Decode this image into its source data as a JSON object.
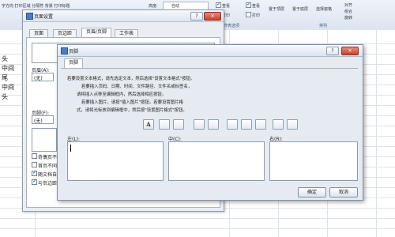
{
  "ribbon": {
    "items_left": "字方向 打印区域 分隔符 背景 打印标题",
    "height_label": "高度:",
    "height_value": "自动",
    "view_label": "查看",
    "view_label2": "查看",
    "print_label": "打印",
    "print_label2": "打印",
    "bring_forward": "置于顶层",
    "send_back": "置于底层",
    "selection_pane": "选择窗格",
    "align": "对齐",
    "group": "组合",
    "rotate": "旋转",
    "sheet_options": "作表选项",
    "arrange": "排列"
  },
  "sheet": {
    "cells": [
      "头",
      "中间",
      "尾",
      "中间",
      "头"
    ]
  },
  "page_setup": {
    "title": "页面设置",
    "help_icon": "?",
    "close_icon": "✕",
    "tabs": [
      "页面",
      "页边距",
      "页眉/页脚",
      "工作表"
    ],
    "header_label": "页眉(A):",
    "header_value": "(无)",
    "footer_label": "页脚(F):",
    "footer_value": "(无)",
    "checkboxes": [
      {
        "label": "奇偶页不同",
        "checked": false
      },
      {
        "label": "首页不同",
        "checked": false
      },
      {
        "label": "随文档自动缩放",
        "checked": true
      },
      {
        "label": "与页边距对齐",
        "checked": true
      }
    ]
  },
  "footer_dialog": {
    "title": "页脚",
    "help_icon": "?",
    "close_icon": "✕",
    "tab": "页脚",
    "instructions": [
      "若要设置文本格式，请先选定文本，然后选择\"设置文本格式\"按钮。",
      "若要插入页码、日期、时间、文件路径、文件名或标签名，",
      "请将插入点移至编辑框内，然后选择相应按钮。",
      "若要插入图片，请按\"插入图片\"按钮。若要设置图片格",
      "式，请将光标放到编辑框中，然后按\"设置图片格式\"按钮。"
    ],
    "sections": [
      {
        "label": "左(L):"
      },
      {
        "label": "中(C):"
      },
      {
        "label": "右(R):"
      }
    ],
    "toolbar_icons": [
      "format-text-icon",
      "page-number-icon",
      "total-pages-icon",
      "date-icon",
      "time-icon",
      "file-path-icon",
      "file-name-icon",
      "sheet-name-icon",
      "insert-picture-icon",
      "format-picture-icon"
    ],
    "ok_label": "确定",
    "cancel_label": "取消"
  }
}
